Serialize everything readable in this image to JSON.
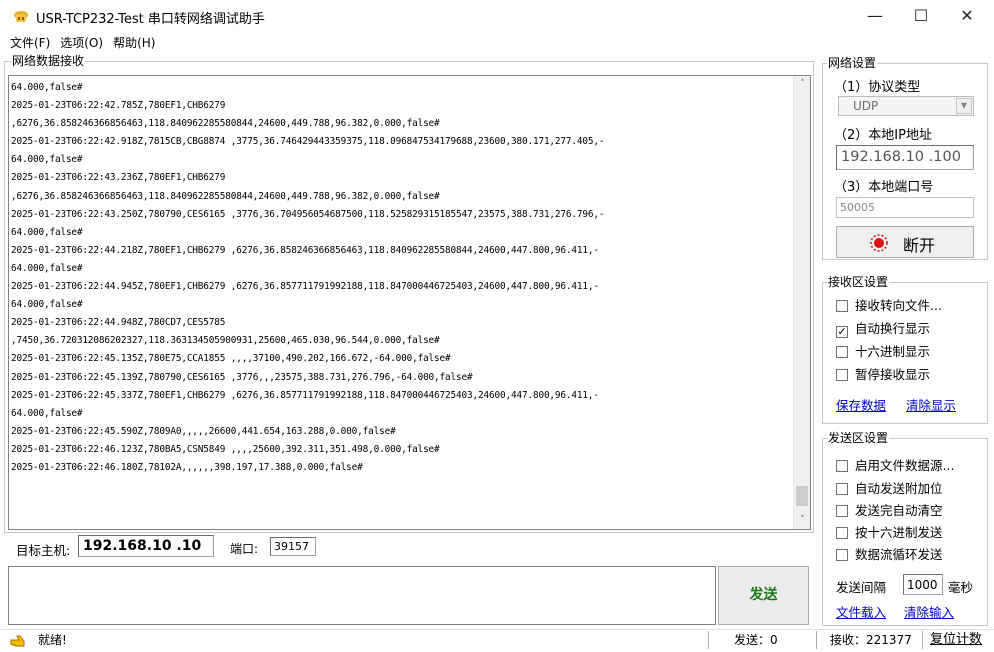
{
  "window": {
    "title": "USR-TCP232-Test 串口转网络调试助手",
    "minimize": "—",
    "maximize": "☐",
    "close": "✕"
  },
  "menu": {
    "items": [
      "文件(F)",
      "选项(O)",
      "帮助(H)"
    ]
  },
  "receive": {
    "group_title": "网络数据接收",
    "lines": [
      "64.000,false#",
      "2025-01-23T06:22:42.785Z,780EF1,CHB6279",
      ",6276,36.858246366856463,118.840962285580844,24600,449.788,96.382,0.000,false#",
      "2025-01-23T06:22:42.918Z,7815CB,CBG8874 ,3775,36.746429443359375,118.096847534179688,23600,380.171,277.405,-",
      "64.000,false#",
      "2025-01-23T06:22:43.236Z,780EF1,CHB6279",
      ",6276,36.858246366856463,118.840962285580844,24600,449.788,96.382,0.000,false#",
      "2025-01-23T06:22:43.250Z,780790,CES6165 ,3776,36.704956054687500,118.525829315185547,23575,388.731,276.796,-",
      "64.000,false#",
      "2025-01-23T06:22:44.218Z,780EF1,CHB6279 ,6276,36.858246366856463,118.840962285580844,24600,447.800,96.411,-",
      "64.000,false#",
      "2025-01-23T06:22:44.945Z,780EF1,CHB6279 ,6276,36.857711791992188,118.847000446725403,24600,447.800,96.411,-",
      "64.000,false#",
      "2025-01-23T06:22:44.948Z,780CD7,CES5785",
      ",7450,36.720312086202327,118.363134505900931,25600,465.030,96.544,0.000,false#",
      "2025-01-23T06:22:45.135Z,780E75,CCA1855 ,,,,37100,490.202,166.672,-64.000,false#",
      "2025-01-23T06:22:45.139Z,780790,CES6165 ,3776,,,23575,388.731,276.796,-64.000,false#",
      "2025-01-23T06:22:45.337Z,780EF1,CHB6279 ,6276,36.857711791992188,118.847000446725403,24600,447.800,96.411,-",
      "64.000,false#",
      "2025-01-23T06:22:45.590Z,7809A0,,,,,26600,441.654,163.288,0.000,false#",
      "2025-01-23T06:22:46.123Z,780BA5,CSN5849 ,,,,25600,392.311,351.498,0.000,false#",
      "2025-01-23T06:22:46.180Z,78102A,,,,,,398.197,17.388,0.000,false#"
    ],
    "scroll_up": "˄",
    "scroll_down": "˅"
  },
  "target": {
    "host_label": "目标主机:",
    "host_value": "192.168.10 .10",
    "port_label": "端口:",
    "port_value": "39157"
  },
  "send": {
    "input_value": "",
    "button_label": "发送"
  },
  "network": {
    "group_title": "网络设置",
    "protocol_label": "（1）协议类型",
    "protocol_value": "UDP",
    "ip_label": "（2）本地IP地址",
    "ip_value": "192.168.10 .100",
    "port_label": "（3）本地端口号",
    "port_value": "50005",
    "disconnect_label": "断开"
  },
  "recv_settings": {
    "group_title": "接收区设置",
    "options": [
      {
        "label": "接收转向文件...",
        "checked": false
      },
      {
        "label": "自动换行显示",
        "checked": true
      },
      {
        "label": "十六进制显示",
        "checked": false
      },
      {
        "label": "暂停接收显示",
        "checked": false
      }
    ],
    "save_link": "保存数据",
    "clear_link": "清除显示"
  },
  "send_settings": {
    "group_title": "发送区设置",
    "options": [
      {
        "label": "启用文件数据源...",
        "checked": false
      },
      {
        "label": "自动发送附加位",
        "checked": false
      },
      {
        "label": "发送完自动清空",
        "checked": false
      },
      {
        "label": "按十六进制发送",
        "checked": false
      },
      {
        "label": "数据流循环发送",
        "checked": false
      }
    ],
    "interval_label": "发送间隔",
    "interval_value": "1000",
    "interval_unit": "毫秒",
    "load_file_link": "文件载入",
    "clear_input_link": "清除输入"
  },
  "status": {
    "ready": "就绪!",
    "sent": "发送：0",
    "received": "接收：221377",
    "reset": "复位计数"
  },
  "colors": {
    "send_button_text": "#1a7a1a",
    "link": "#0000cc",
    "record_icon": "#e01010"
  }
}
